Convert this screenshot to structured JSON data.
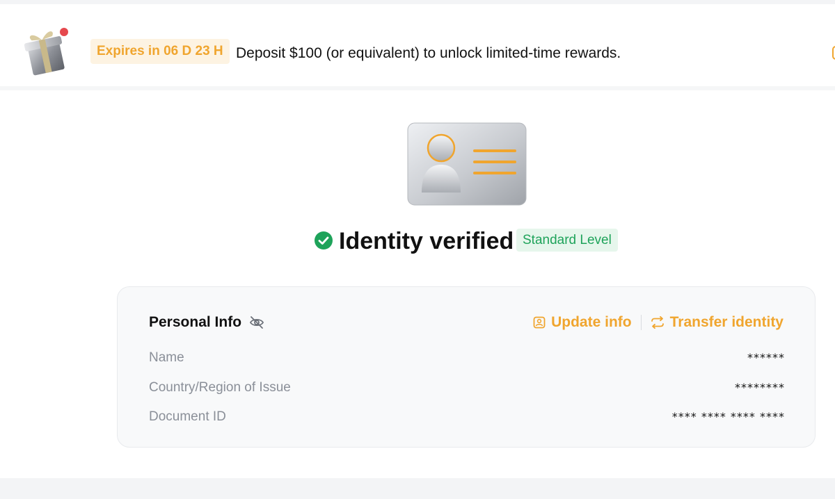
{
  "banner": {
    "icon": "gift-icon",
    "expiry_badge": "Expires in 06 D 23 H",
    "message": "Deposit $100 (or equivalent) to unlock limited-time rewards."
  },
  "verification": {
    "illustration": "id-card-icon",
    "status_icon": "check-circle-icon",
    "title": "Identity verified",
    "level": "Standard Level"
  },
  "personal_info": {
    "title": "Personal Info",
    "visibility_icon": "eye-off-icon",
    "actions": [
      {
        "label": "Update info",
        "icon": "id-badge-icon"
      },
      {
        "label": "Transfer identity",
        "icon": "transfer-arrows-icon"
      }
    ],
    "fields": [
      {
        "label": "Name",
        "value": "******"
      },
      {
        "label": "Country/Region of Issue",
        "value": "********"
      },
      {
        "label": "Document ID",
        "value": "**** **** **** ****"
      }
    ]
  },
  "colors": {
    "accent": "#f0a52e",
    "success": "#1ea35a",
    "success_bg": "#e6f6ec",
    "muted_text": "#8a8f98"
  }
}
